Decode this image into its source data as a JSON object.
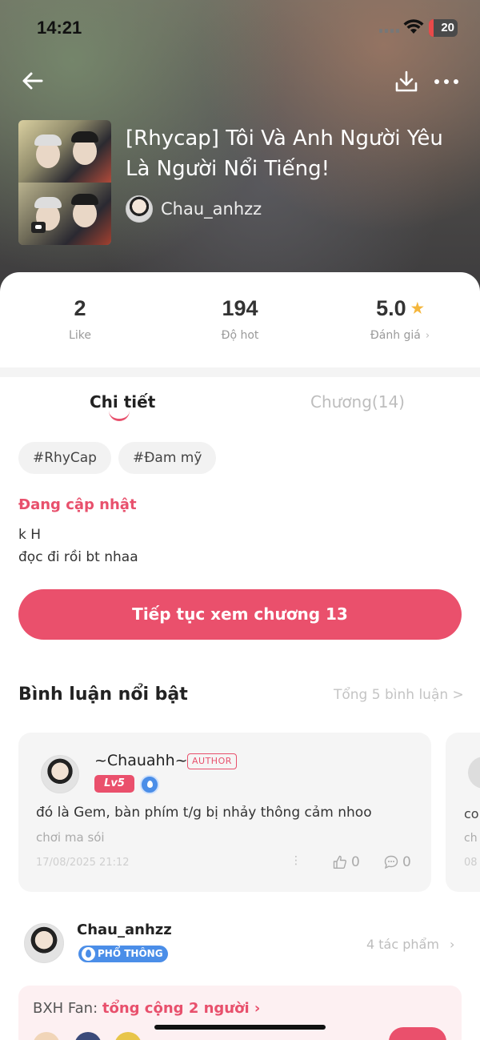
{
  "status_bar": {
    "time": "14:21",
    "battery": "20"
  },
  "header": {
    "title": "[Rhycap] Tôi Và Anh Người Yêu Là Người Nổi Tiếng!",
    "author": "Chau_anhzz"
  },
  "icons": {
    "back": "arrow-left-icon",
    "download": "download-icon",
    "more": "more-icon"
  },
  "stats": [
    {
      "value": "2",
      "label": "Like"
    },
    {
      "value": "194",
      "label": "Độ hot"
    },
    {
      "value": "5.0",
      "label": "Đánh giá"
    }
  ],
  "tabs": {
    "detail": "Chi tiết",
    "chapters": "Chương(14)"
  },
  "tags": [
    "#RhyCap",
    "#Đam mỹ"
  ],
  "status_label": "Đang cập nhật",
  "description": [
    "k H",
    "đọc đi rồi bt nhaa"
  ],
  "cta": "Tiếp tục xem chương 13",
  "comments_section": {
    "title": "Bình luận nổi bật",
    "total": "Tổng 5 bình luận >"
  },
  "comment": {
    "user": "~Chauahh~",
    "author_badge": "AUTHOR",
    "level": "Lv5",
    "text": "đó là Gem, bàn phím t/g bị nhảy thông cảm nhoo",
    "sub": "chơi ma sói",
    "date": "17/08/2025 21:12",
    "likes": "0",
    "replies": "0"
  },
  "comment_next": {
    "text": "co",
    "sub": "ch",
    "date": "08"
  },
  "author_section": {
    "name": "Chau_anhzz",
    "badge": "PHỔ THÔNG",
    "works": "4 tác phẩm"
  },
  "fan": {
    "label": "BXH Fan:",
    "count": "tổng cộng 2 người"
  },
  "colors": {
    "accent": "#ea506c",
    "badge_blue": "#4b8ee8",
    "star": "#f4b63c"
  }
}
